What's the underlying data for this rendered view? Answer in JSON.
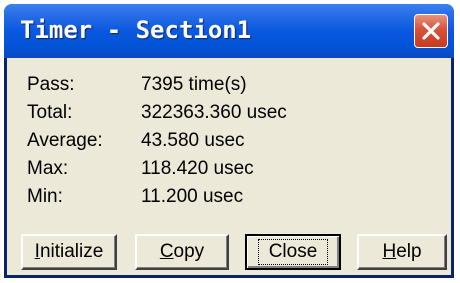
{
  "window": {
    "title": "Timer - Section1"
  },
  "stats": [
    {
      "label": "Pass:",
      "value": "7395 time(s)"
    },
    {
      "label": "Total:",
      "value": "322363.360 usec"
    },
    {
      "label": "Average:",
      "value": "43.580 usec"
    },
    {
      "label": "Max:",
      "value": "118.420 usec"
    },
    {
      "label": "Min:",
      "value": "11.200 usec"
    }
  ],
  "buttons": {
    "initialize": {
      "mnemonic": "I",
      "rest": "nitialize"
    },
    "copy": {
      "mnemonic": "C",
      "rest": "opy"
    },
    "close": {
      "label": "Close"
    },
    "help": {
      "mnemonic": "H",
      "rest": "elp"
    }
  },
  "icons": {
    "close": "close-icon"
  },
  "colors": {
    "titlebar": "#0a58e0",
    "window_bg": "#ece9d8",
    "close_button": "#d8523a"
  }
}
